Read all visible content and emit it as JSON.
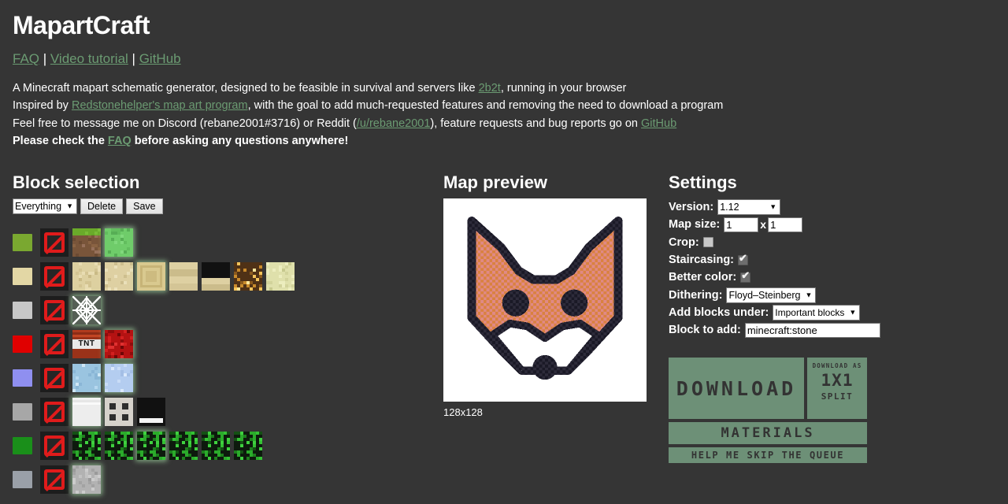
{
  "app": {
    "title": "MapartCraft"
  },
  "nav": {
    "links": [
      {
        "label": "FAQ"
      },
      {
        "label": "Video tutorial"
      },
      {
        "label": "GitHub"
      }
    ],
    "separator": " | "
  },
  "description": {
    "line1_a": "A Minecraft mapart schematic generator, designed to be feasible in survival and servers like ",
    "line1_link": "2b2t",
    "line1_b": ", running in your browser",
    "line2_a": "Inspired by ",
    "line2_link": "Redstonehelper's map art program",
    "line2_b": ", with the goal to add much-requested features and removing the need to download a program",
    "line3_a": "Feel free to message me on Discord (rebane2001#3716) or Reddit (",
    "line3_link": "/u/rebane2001",
    "line3_b": "), feature requests and bug reports go on ",
    "line3_link2": "GitHub",
    "line4_a": "Please check the ",
    "line4_link": "FAQ",
    "line4_b": " before asking any questions anywhere!"
  },
  "block_selection": {
    "title": "Block selection",
    "preset_selected": "Everything",
    "delete_label": "Delete",
    "save_label": "Save",
    "rows": [
      {
        "swatch": "#7aa830",
        "blocks": [
          {
            "name": "none",
            "kind": "none"
          },
          {
            "name": "grass-block",
            "kind": "grass",
            "selected": false
          },
          {
            "name": "slime-block",
            "kind": "slime",
            "selected": true
          }
        ]
      },
      {
        "swatch": "#e3d7a5",
        "blocks": [
          {
            "name": "none",
            "kind": "none"
          },
          {
            "name": "sand",
            "kind": "sand",
            "selected": false
          },
          {
            "name": "sandstone",
            "kind": "sandstone",
            "selected": false
          },
          {
            "name": "chiseled-sandstone",
            "kind": "chiseled-sandstone",
            "selected": true
          },
          {
            "name": "cut-sandstone",
            "kind": "cut-sandstone",
            "selected": false
          },
          {
            "name": "sandstone-slab",
            "kind": "sandstone-slab",
            "selected": false
          },
          {
            "name": "glowstone",
            "kind": "glowstone",
            "selected": false
          },
          {
            "name": "end-stone",
            "kind": "end-stone",
            "selected": false
          }
        ]
      },
      {
        "swatch": "#c7c7c7",
        "blocks": [
          {
            "name": "none",
            "kind": "none"
          },
          {
            "name": "cobweb",
            "kind": "cobweb",
            "selected": true
          }
        ]
      },
      {
        "swatch": "#e00000",
        "blocks": [
          {
            "name": "none",
            "kind": "none"
          },
          {
            "name": "tnt",
            "kind": "tnt",
            "selected": false
          },
          {
            "name": "redstone-block",
            "kind": "redstone-block",
            "selected": true
          }
        ]
      },
      {
        "swatch": "#8f8ff0",
        "blocks": [
          {
            "name": "none",
            "kind": "none"
          },
          {
            "name": "ice",
            "kind": "ice",
            "selected": false
          },
          {
            "name": "packed-ice",
            "kind": "packed-ice",
            "selected": true
          }
        ]
      },
      {
        "swatch": "#a7a7a7",
        "blocks": [
          {
            "name": "none",
            "kind": "none"
          },
          {
            "name": "white-concrete",
            "kind": "white-block",
            "selected": true
          },
          {
            "name": "white-stained-terracotta",
            "kind": "terracotta-white",
            "selected": false
          },
          {
            "name": "snow-slab",
            "kind": "snow-slab",
            "selected": false
          }
        ]
      },
      {
        "swatch": "#1a8f1a",
        "blocks": [
          {
            "name": "none",
            "kind": "none"
          },
          {
            "name": "oak-leaves",
            "kind": "leaves",
            "selected": false
          },
          {
            "name": "spruce-leaves",
            "kind": "leaves",
            "selected": false
          },
          {
            "name": "birch-leaves",
            "kind": "leaves",
            "selected": true
          },
          {
            "name": "jungle-leaves",
            "kind": "leaves",
            "selected": false
          },
          {
            "name": "acacia-leaves",
            "kind": "leaves",
            "selected": false
          },
          {
            "name": "dark-oak-leaves",
            "kind": "leaves",
            "selected": false
          }
        ]
      },
      {
        "swatch": "#9aa0a8",
        "blocks": [
          {
            "name": "none",
            "kind": "none"
          },
          {
            "name": "stone",
            "kind": "stone",
            "selected": true
          }
        ]
      }
    ]
  },
  "map_preview": {
    "title": "Map preview",
    "size_label": "128x128",
    "alt": "fox-face-mapart"
  },
  "settings": {
    "title": "Settings",
    "version_label": "Version:",
    "version_value": "1.12",
    "mapsize_label": "Map size:",
    "mapsize_width": "1",
    "mapsize_x": "x",
    "mapsize_height": "1",
    "crop_label": "Crop:",
    "crop_checked": false,
    "staircasing_label": "Staircasing:",
    "staircasing_checked": true,
    "better_color_label": "Better color:",
    "better_color_checked": true,
    "dithering_label": "Dithering:",
    "dithering_value": "Floyd–Steinberg",
    "blocks_under_label": "Add blocks under:",
    "blocks_under_value": "Important blocks",
    "block_to_add_label": "Block to add:",
    "block_to_add_value": "minecraft:stone"
  },
  "actions": {
    "download_label": "DOWNLOAD",
    "split_caption": "DOWNLOAD AS",
    "split_big": "1X1",
    "split_sub": "SPLIT",
    "materials_label": "MATERIALS",
    "skip_queue_label": "HELP ME SKIP THE QUEUE",
    "accent_color": "#6d9077"
  }
}
